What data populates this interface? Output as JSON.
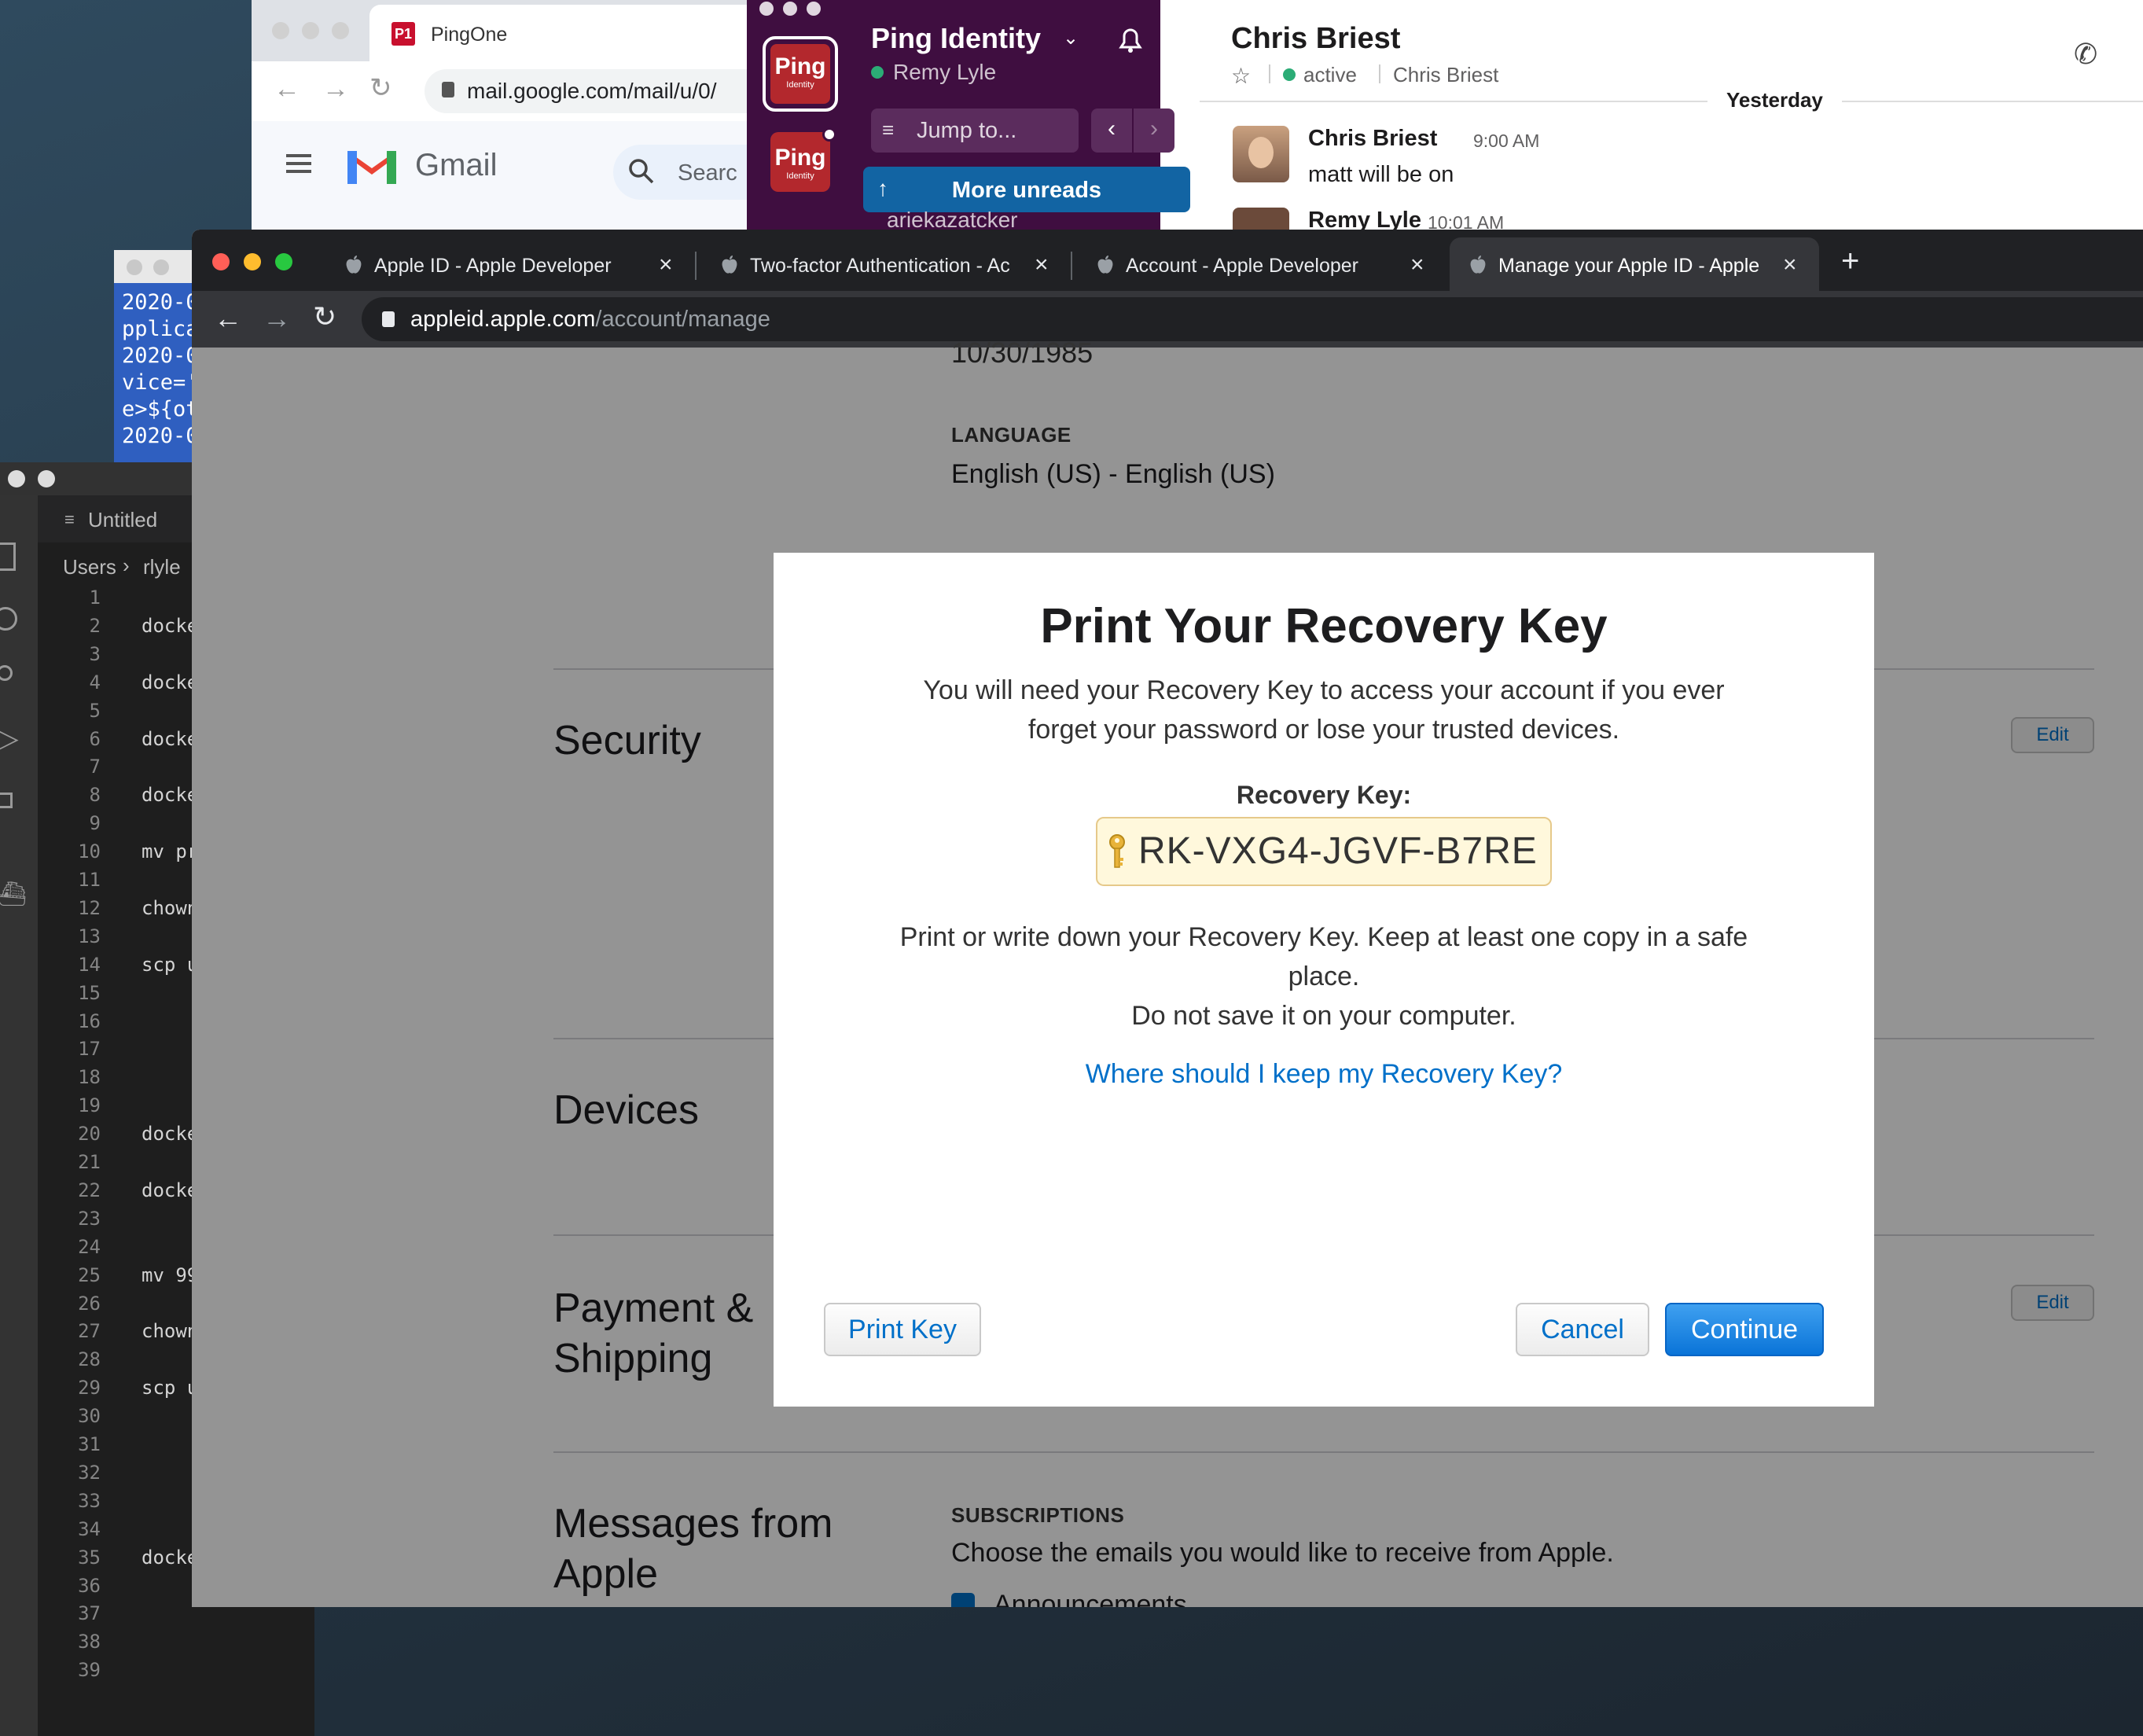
{
  "gmail": {
    "tab_title": "PingOne",
    "favicon_text": "P1",
    "url": "mail.google.com/mail/u/0/",
    "logo_text": "Gmail",
    "search_placeholder": "Searc"
  },
  "slack": {
    "workspace": "Ping Identity",
    "user": "Remy Lyle",
    "workspace_icon_text": "Ping",
    "workspace_icon_sub": "Identity",
    "jump_to": "Jump to...",
    "more_unreads": "More unreads",
    "partial_channel": "ariekazatcker",
    "channel_title": "Chris Briest",
    "status": "active",
    "status_name": "Chris Briest",
    "day_divider": "Yesterday",
    "messages": [
      {
        "author": "Chris Briest",
        "time": "9:00 AM",
        "text": "matt will be on"
      },
      {
        "author": "Remy Lyle",
        "time": "10:01 AM",
        "text": ""
      }
    ]
  },
  "textedit": {
    "lines": [
      "2020-0",
      "pplica",
      "2020-0",
      "vice='",
      "e>${ot",
      "2020-0"
    ]
  },
  "vscode": {
    "tab": "Untitled",
    "breadcrumb_a": "Users",
    "breadcrumb_b": "rlyle",
    "line_numbers": [
      "1",
      "2",
      "3",
      "4",
      "5",
      "6",
      "7",
      "8",
      "9",
      "10",
      "11",
      "12",
      "13",
      "14",
      "15",
      "16",
      "17",
      "18",
      "19",
      "20",
      "21",
      "22",
      "23",
      "24",
      "25",
      "26",
      "27",
      "28",
      "29",
      "30",
      "31",
      "32",
      "33",
      "34",
      "35",
      "36",
      "37",
      "38",
      "39"
    ],
    "code": {
      "2": "docke",
      "4": "docke",
      "6": "docke",
      "8": "docke",
      "10": "mv pr",
      "12": "chown",
      "14": "scp u",
      "20": "docke",
      "22": "docke",
      "25": "mv 99",
      "27": "chown",
      "29": "scp u",
      "35": "docke"
    }
  },
  "chrome": {
    "tabs": [
      {
        "title": "Apple ID - Apple Developer"
      },
      {
        "title": "Two-factor Authentication - Ac"
      },
      {
        "title": "Account - Apple Developer"
      },
      {
        "title": "Manage your Apple ID - Apple"
      }
    ],
    "url_host": "appleid.apple.com",
    "url_path": "/account/manage"
  },
  "apple_page": {
    "birthday": "10/30/1985",
    "language_label": "LANGUAGE",
    "language_value": "English (US) - English (US)",
    "security": "Security",
    "devices": "Devices",
    "payment_line1": "Payment &",
    "payment_line2": "Shipping",
    "messages_line1": "Messages from",
    "messages_line2": "Apple",
    "edit": "Edit",
    "subscriptions_label": "SUBSCRIPTIONS",
    "subscriptions_text": "Choose the emails you would like to receive from Apple.",
    "announcements": "Announcements"
  },
  "modal": {
    "title": "Print Your Recovery Key",
    "intro_line1": "You will need your Recovery Key to access your account if you ever",
    "intro_line2": "forget your password or lose your trusted devices.",
    "key_label": "Recovery Key:",
    "key_value": "RK-VXG4-JGVF-B7RE",
    "print_line1": "Print or write down your Recovery Key. Keep at least one copy in a safe",
    "print_line2": "place.",
    "print_line3": "Do not save it on your computer.",
    "help_link": "Where should I keep my Recovery Key?",
    "print_button": "Print Key",
    "cancel_button": "Cancel",
    "continue_button": "Continue"
  },
  "colors": {
    "apple_link": "#0070c9",
    "slack_purple": "#3f0e40",
    "slack_unreads": "#1264a3",
    "key_bg": "#fff8dc"
  }
}
